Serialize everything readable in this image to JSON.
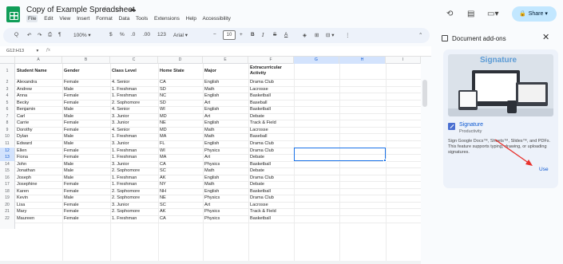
{
  "doc": {
    "title": "Copy of Example Spreadsheet",
    "title_icons": [
      "star-icon",
      "folder-move-icon",
      "cloud-status-icon"
    ],
    "menu": [
      "File",
      "Edit",
      "View",
      "Insert",
      "Format",
      "Data",
      "Tools",
      "Extensions",
      "Help",
      "Accessibility"
    ]
  },
  "header": {
    "share_label": "Share",
    "icons": [
      "history-icon",
      "comments-icon",
      "meet-icon"
    ]
  },
  "toolbar": {
    "items": [
      {
        "name": "search-menus-icon",
        "glyph": "Q"
      },
      {
        "name": "undo-icon",
        "glyph": "↶"
      },
      {
        "name": "redo-icon",
        "glyph": "↷"
      },
      {
        "name": "print-icon",
        "glyph": "⎙"
      },
      {
        "name": "paint-format-icon",
        "glyph": "¶"
      },
      {
        "name": "zoom-select",
        "glyph": "100% ▾"
      },
      {
        "name": "currency-button",
        "glyph": "$"
      },
      {
        "name": "percent-button",
        "glyph": "%"
      },
      {
        "name": "decrease-decimal-button",
        "glyph": ".0"
      },
      {
        "name": "increase-decimal-button",
        "glyph": ".00"
      },
      {
        "name": "more-formats-button",
        "glyph": "123"
      },
      {
        "name": "font-select",
        "glyph": "Arial ▾"
      },
      {
        "name": "font-size-decrease",
        "glyph": "−"
      },
      {
        "name": "font-size-increase",
        "glyph": "+"
      },
      {
        "name": "bold-button",
        "glyph": "B"
      },
      {
        "name": "italic-button",
        "glyph": "I"
      },
      {
        "name": "strikethrough-button",
        "glyph": "S"
      },
      {
        "name": "text-color-button",
        "glyph": "A"
      },
      {
        "name": "fill-color-button",
        "glyph": "◈"
      },
      {
        "name": "borders-button",
        "glyph": "⊞"
      },
      {
        "name": "merge-cells-button",
        "glyph": "⊟ ▾"
      },
      {
        "name": "more-options-button",
        "glyph": "⋮"
      },
      {
        "name": "collapse-toolbar-icon",
        "glyph": "⌃"
      }
    ],
    "font_size": "10"
  },
  "formula_bar": {
    "cell_ref": "G12:H13",
    "fx": "fx"
  },
  "columns": [
    "A",
    "B",
    "C",
    "D",
    "E",
    "F",
    "G",
    "H",
    "I"
  ],
  "rows": [
    [
      "Student Name",
      "Gender",
      "Class Level",
      "Home State",
      "Major",
      "Extracurricular Activity"
    ],
    [
      "Alexandra",
      "Female",
      "4. Senior",
      "CA",
      "English",
      "Drama Club"
    ],
    [
      "Andrew",
      "Male",
      "1. Freshman",
      "SD",
      "Math",
      "Lacrosse"
    ],
    [
      "Anna",
      "Female",
      "1. Freshman",
      "NC",
      "English",
      "Basketball"
    ],
    [
      "Becky",
      "Female",
      "2. Sophomore",
      "SD",
      "Art",
      "Baseball"
    ],
    [
      "Benjamin",
      "Male",
      "4. Senior",
      "WI",
      "English",
      "Basketball"
    ],
    [
      "Carl",
      "Male",
      "3. Junior",
      "MD",
      "Art",
      "Debate"
    ],
    [
      "Carrie",
      "Female",
      "3. Junior",
      "NE",
      "English",
      "Track & Field"
    ],
    [
      "Dorothy",
      "Female",
      "4. Senior",
      "MD",
      "Math",
      "Lacrosse"
    ],
    [
      "Dylan",
      "Male",
      "1. Freshman",
      "MA",
      "Math",
      "Baseball"
    ],
    [
      "Edward",
      "Male",
      "3. Junior",
      "FL",
      "English",
      "Drama Club"
    ],
    [
      "Ellen",
      "Female",
      "1. Freshman",
      "WI",
      "Physics",
      "Drama Club"
    ],
    [
      "Fiona",
      "Female",
      "1. Freshman",
      "MA",
      "Art",
      "Debate"
    ],
    [
      "John",
      "Male",
      "3. Junior",
      "CA",
      "Physics",
      "Basketball"
    ],
    [
      "Jonathan",
      "Male",
      "2. Sophomore",
      "SC",
      "Math",
      "Debate"
    ],
    [
      "Joseph",
      "Male",
      "1. Freshman",
      "AK",
      "English",
      "Drama Club"
    ],
    [
      "Josephine",
      "Female",
      "1. Freshman",
      "NY",
      "Math",
      "Debate"
    ],
    [
      "Karen",
      "Female",
      "2. Sophomore",
      "NH",
      "English",
      "Basketball"
    ],
    [
      "Kevin",
      "Male",
      "2. Sophomore",
      "NE",
      "Physics",
      "Drama Club"
    ],
    [
      "Lisa",
      "Female",
      "3. Junior",
      "SC",
      "Art",
      "Lacrosse"
    ],
    [
      "Mary",
      "Female",
      "2. Sophomore",
      "AK",
      "Physics",
      "Track & Field"
    ],
    [
      "Maureen",
      "Female",
      "1. Freshman",
      "CA",
      "Physics",
      "Basketball"
    ]
  ],
  "selected_rows": [
    12,
    13
  ],
  "selected_cols": [
    "G",
    "H"
  ],
  "panel": {
    "title": "Document add-ons",
    "close": "✕",
    "banner_title": "Signature",
    "addon_name": "Signature",
    "addon_category": "Productivity",
    "addon_description": "Sign Google Docs™, Sheets™, Slides™, and PDFs. This feature supports typing, drawing, or uploading signatures.",
    "use_label": "Use"
  },
  "colors": {
    "accent": "#0b57d0",
    "share_bg": "#c2e7ff",
    "sheets_green": "#0f9d58",
    "arrow": "#e8322d"
  }
}
